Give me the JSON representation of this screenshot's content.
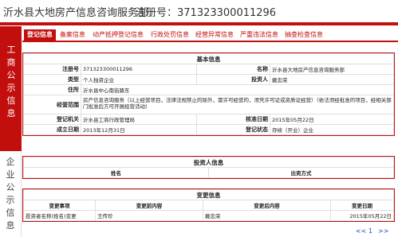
{
  "header": {
    "company_name": "沂水县大地房产信息咨询服务部",
    "reg_label": "注册号：371323300011296"
  },
  "side": {
    "gov_label": "工商公示信息",
    "ent_label": "企业公示信息"
  },
  "tabs": [
    {
      "label": "登记信息",
      "active": true
    },
    {
      "label": "备案信息",
      "active": false
    },
    {
      "label": "动产抵押登记信息",
      "active": false
    },
    {
      "label": "行政处罚信息",
      "active": false
    },
    {
      "label": "经营异常信息",
      "active": false
    },
    {
      "label": "严重违法信息",
      "active": false
    },
    {
      "label": "抽查检查信息",
      "active": false
    }
  ],
  "basic": {
    "title": "基本信息",
    "reg_no_label": "注册号",
    "reg_no": "371323300011296",
    "name_label": "名称",
    "name": "沂水县大地房产信息咨询服务部",
    "type_label": "类型",
    "type": "个人独资企业",
    "investor_label": "投资人",
    "investor": "戴忠荣",
    "address_label": "住所",
    "address": "沂水县中心南街路东",
    "scope_label": "经营范围",
    "scope": "房产信息咨询服务（以上经营项目，法律法规禁止的除外，需许可经营的，须凭许可证或资质证经营）（依法须经批准的项目，经相关部门批准后方可开展经营活动）",
    "authority_label": "登记机关",
    "authority": "沂水县工商行政管理局",
    "approval_label": "核准日期",
    "approval": "2015年05月22日",
    "established_label": "成立日期",
    "established": "2013年12月31日",
    "status_label": "登记状态",
    "status": "存续（开业）企业"
  },
  "investors": {
    "title": "投资人信息",
    "col_name": "姓名",
    "col_method": "出资方式"
  },
  "changes": {
    "title": "变更信息",
    "col_item": "变更事项",
    "col_before": "变更前内容",
    "col_after": "变更后内容",
    "col_date": "变更日期",
    "rows": [
      {
        "item": "投资者名称(姓名)变更",
        "before": "王传珍",
        "after": "戴忠荣",
        "date": "2015年05月22日"
      }
    ]
  },
  "pager": {
    "prev": "<<",
    "page": "1",
    "next": ">>"
  }
}
